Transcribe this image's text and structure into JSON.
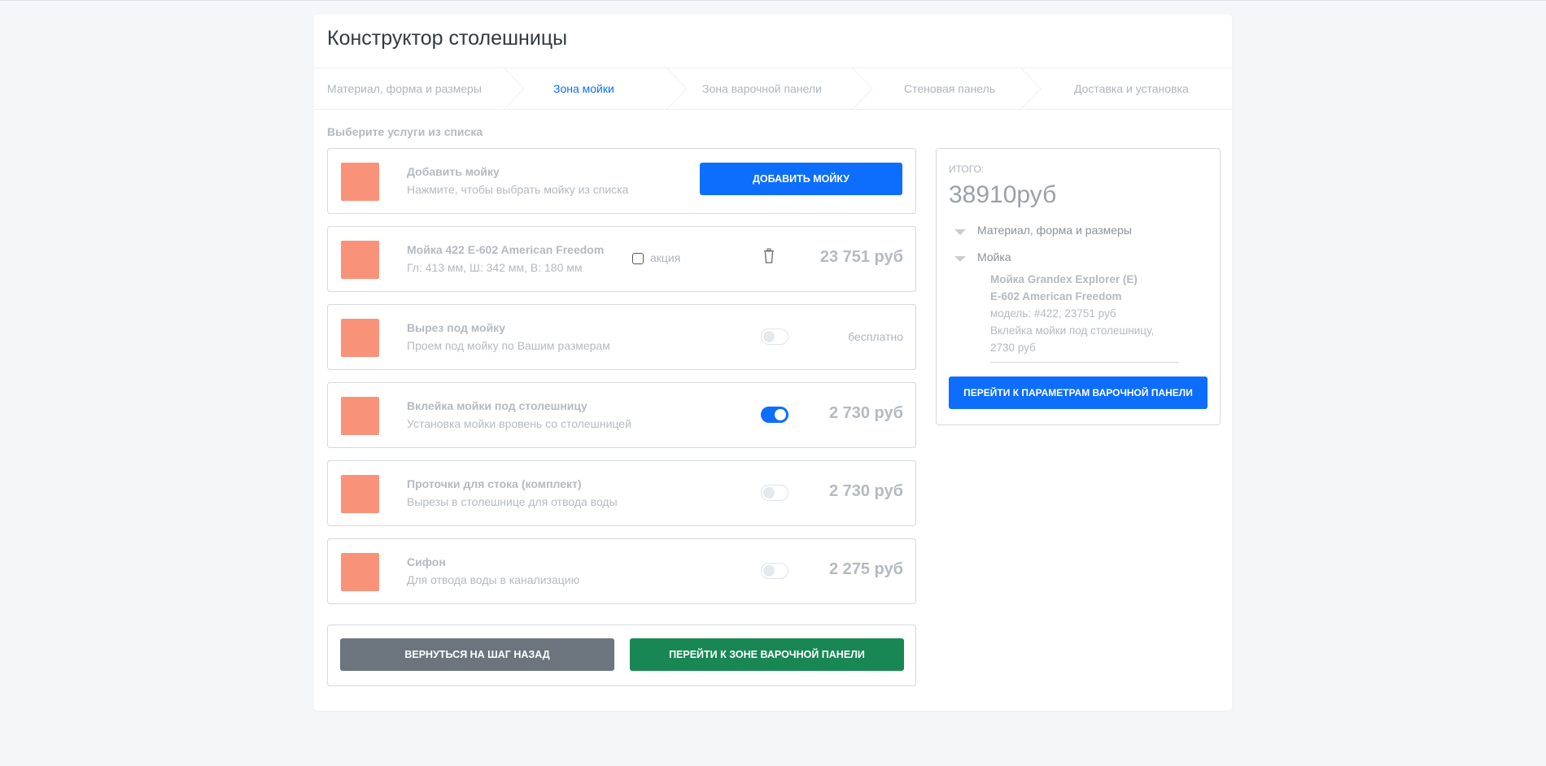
{
  "page": {
    "title": "Конструктор столешницы"
  },
  "steps": [
    {
      "label": "Материал, форма и размеры",
      "state": "done"
    },
    {
      "label": "Зона мойки",
      "state": "active"
    },
    {
      "label": "Зона варочной панели",
      "state": "pending"
    },
    {
      "label": "Стеновая панель",
      "state": "pending"
    },
    {
      "label": "Доставка и установка",
      "state": "pending"
    }
  ],
  "subtitle": "Выберите услуги из списка",
  "add_sink": {
    "name": "Добавить мойку",
    "desc": "Нажмите, чтобы выбрать мойку из списка",
    "button": "ДОБАВИТЬ МОЙКУ"
  },
  "sink": {
    "name": "Мойка 422 E-602 American Freedom",
    "desc": "Гл: 413 мм, Ш: 342 мм, В: 180 мм",
    "promo_label": "акция",
    "promo_checked": false,
    "price": "23 751 руб"
  },
  "services": [
    {
      "name": "Вырез под мойку",
      "desc": "Проем под мойку по Вашим размерам",
      "enabled": false,
      "price": "бесплатно"
    },
    {
      "name": "Вклейка мойки под столешницу",
      "desc": "Установка мойки вровень со столешницей",
      "enabled": true,
      "price": "2 730 руб"
    },
    {
      "name": "Проточки для стока (комплект)",
      "desc": "Вырезы в столешнице для отвода воды",
      "enabled": false,
      "price": "2 730 руб"
    },
    {
      "name": "Сифон",
      "desc": "Для отвода воды в канализацию",
      "enabled": false,
      "price": "2 275 руб"
    }
  ],
  "nav": {
    "back": "ВЕРНУТЬСЯ НА ШАГ НАЗАД",
    "next": "ПЕРЕЙТИ К ЗОНЕ ВАРОЧНОЙ ПАНЕЛИ"
  },
  "summary": {
    "label": "ИТОГО:",
    "total": "38910руб",
    "sections": [
      "Материал, форма и размеры",
      "Мойка"
    ],
    "detail_name_1": "Мойка Grandex Explorer (E)",
    "detail_name_2": "E-602 American Freedom",
    "detail_model": "модель: #422, 23751 руб",
    "detail_glue_1": "Вклейка мойки под столешницу,",
    "detail_glue_2": "2730 руб",
    "button": "ПЕРЕЙТИ К ПАРАМЕТРАМ ВАРОЧНОЙ ПАНЕЛИ"
  },
  "colors": {
    "primary": "#0d6efd",
    "success": "#198754",
    "secondary": "#6c757d",
    "thumb": "#f8937a"
  },
  "icons": [
    "chevron-step-icon",
    "trash-icon",
    "triangle-down-icon"
  ]
}
